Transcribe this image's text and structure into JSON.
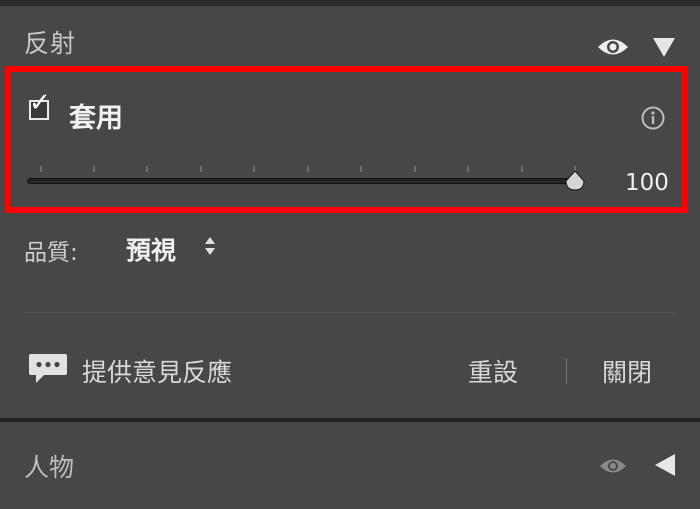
{
  "reflection_panel": {
    "title": "反射",
    "visibility_icon": "eye-icon",
    "collapse_icon": "triangle-down-icon"
  },
  "apply": {
    "checked": true,
    "label": "套用",
    "info_icon": "info-icon",
    "slider_value": "100",
    "slider_fraction": 1.0
  },
  "quality": {
    "label": "品質:",
    "value": "預視"
  },
  "footer": {
    "feedback_label": "提供意見反應",
    "reset_label": "重設",
    "close_label": "關閉"
  },
  "people_panel": {
    "title": "人物",
    "visibility_icon": "eye-icon",
    "expand_icon": "triangle-left-icon"
  },
  "colors": {
    "panel_bg": "#474747",
    "highlight": "#ff0000"
  }
}
